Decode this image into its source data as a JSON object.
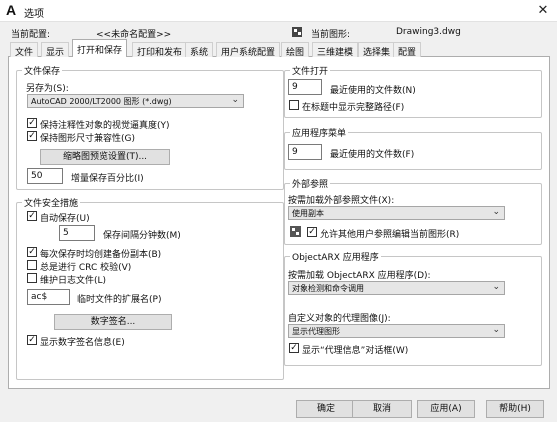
{
  "window": {
    "title": "选项"
  },
  "profile": {
    "current_config_label": "当前配置:",
    "current_config_value": "<<未命名配置>>",
    "current_drawing_label": "当前图形:",
    "current_drawing_value": "Drawing3.dwg"
  },
  "tabs": [
    {
      "label": "文件"
    },
    {
      "label": "显示"
    },
    {
      "label": "打开和保存",
      "active": true
    },
    {
      "label": "打印和发布"
    },
    {
      "label": "系统"
    },
    {
      "label": "用户系统配置"
    },
    {
      "label": "绘图"
    },
    {
      "label": "三维建模"
    },
    {
      "label": "选择集"
    },
    {
      "label": "配置"
    }
  ],
  "file_save": {
    "title": "文件保存",
    "save_as_label": "另存为(S):",
    "save_as_value": "AutoCAD 2000/LT2000 图形 (*.dwg)",
    "cb_annotative": {
      "label": "保持注释性对象的视觉逼真度(Y)",
      "checked": true
    },
    "cb_drawing_size": {
      "label": "保持图形尺寸兼容性(G)",
      "checked": true
    },
    "thumbnail_button": "缩略图预览设置(T)...",
    "incremental_value": "50",
    "incremental_label": "增量保存百分比(I)"
  },
  "file_safety": {
    "title": "文件安全措施",
    "cb_autosave": {
      "label": "自动保存(U)",
      "checked": true
    },
    "autosave_minutes_value": "5",
    "autosave_minutes_label": "保存间隔分钟数(M)",
    "cb_backup": {
      "label": "每次保存时均创建备份副本(B)",
      "checked": true
    },
    "cb_crc": {
      "label": "总是进行 CRC 校验(V)",
      "checked": false
    },
    "cb_log": {
      "label": "维护日志文件(L)",
      "checked": false
    },
    "temp_ext_value": "ac$",
    "temp_ext_label": "临时文件的扩展名(P)",
    "digital_sig_button": "数字签名...",
    "cb_show_sig": {
      "label": "显示数字签名信息(E)",
      "checked": true
    }
  },
  "file_open": {
    "title": "文件打开",
    "recent_value": "9",
    "recent_label": "最近使用的文件数(N)",
    "cb_full_path": {
      "label": "在标题中显示完整路径(F)",
      "checked": false
    }
  },
  "app_menu": {
    "title": "应用程序菜单",
    "recent_value": "9",
    "recent_label": "最近使用的文件数(F)"
  },
  "xref": {
    "title": "外部参照",
    "demand_load_label": "按需加载外部参照文件(X):",
    "demand_load_value": "使用副本",
    "cb_allow_edit": {
      "label": "允许其他用户参照编辑当前图形(R)",
      "checked": true
    }
  },
  "objectarx": {
    "title": "ObjectARX 应用程序",
    "demand_load_label": "按需加载 ObjectARX 应用程序(D):",
    "demand_load_value": "对象检测和命令调用",
    "proxy_images_label": "自定义对象的代理图像(J):",
    "proxy_images_value": "显示代理图形",
    "cb_proxy_dialog": {
      "label": "显示“代理信息”对话框(W)",
      "checked": true
    }
  },
  "buttons": {
    "ok": "确定",
    "cancel": "取消",
    "apply": "应用(A)",
    "help": "帮助(H)"
  },
  "checkmark": "✓"
}
